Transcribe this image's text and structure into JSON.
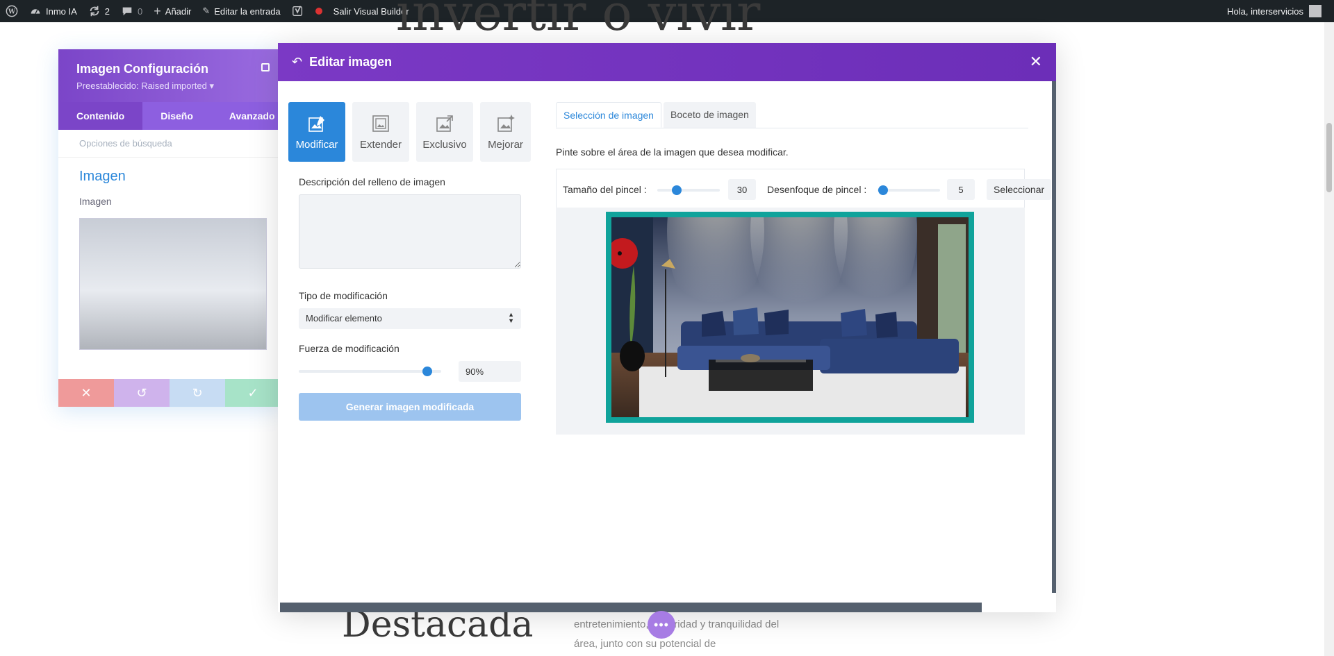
{
  "adminbar": {
    "site_name": "Inmo IA",
    "updates_count": "2",
    "comments_count": "0",
    "add_label": "Añadir",
    "edit_label": "Editar la entrada",
    "exit_builder_label": "Salir Visual Builder",
    "greeting": "Hola, interservicios"
  },
  "background": {
    "heading_top": "invertir o vivir",
    "heading_bottom": "Destacada",
    "paragraph": "entretenimiento, seguridad y tranquilidad del área, junto con su potencial de"
  },
  "settings_panel": {
    "title": "Imagen Configuración",
    "preset": "Preestablecido: Raised imported ▾",
    "tabs": [
      "Contenido",
      "Diseño",
      "Avanzado"
    ],
    "search_placeholder": "Opciones de búsqueda",
    "section_title": "Imagen",
    "field_label": "Imagen"
  },
  "modal": {
    "title": "Editar imagen",
    "modes": [
      {
        "label": "Modificar",
        "icon": "image-edit-icon"
      },
      {
        "label": "Extender",
        "icon": "image-extend-icon"
      },
      {
        "label": "Exclusivo",
        "icon": "image-exclusive-icon"
      },
      {
        "label": "Mejorar",
        "icon": "image-enhance-icon"
      }
    ],
    "fill_description_label": "Descripción del relleno de imagen",
    "fill_description_value": "",
    "modification_type_label": "Tipo de modificación",
    "modification_type_value": "Modificar elemento",
    "modification_strength_label": "Fuerza de modificación",
    "modification_strength_value": "90%",
    "modification_strength_fraction": 0.9,
    "generate_button": "Generar imagen modificada",
    "sub_tabs": [
      "Selección de imagen",
      "Boceto de imagen"
    ],
    "instruction": "Pinte sobre el área de la imagen que desea modificar.",
    "brush_size_label": "Tamaño del pincel :",
    "brush_size_value": "30",
    "brush_blur_label": "Desenfoque de pincel :",
    "brush_blur_value": "5",
    "select_button": "Seleccionar"
  },
  "colors": {
    "accent_purple": "#7b39c5",
    "accent_blue": "#2b87da",
    "frame_teal": "#10a39b"
  }
}
